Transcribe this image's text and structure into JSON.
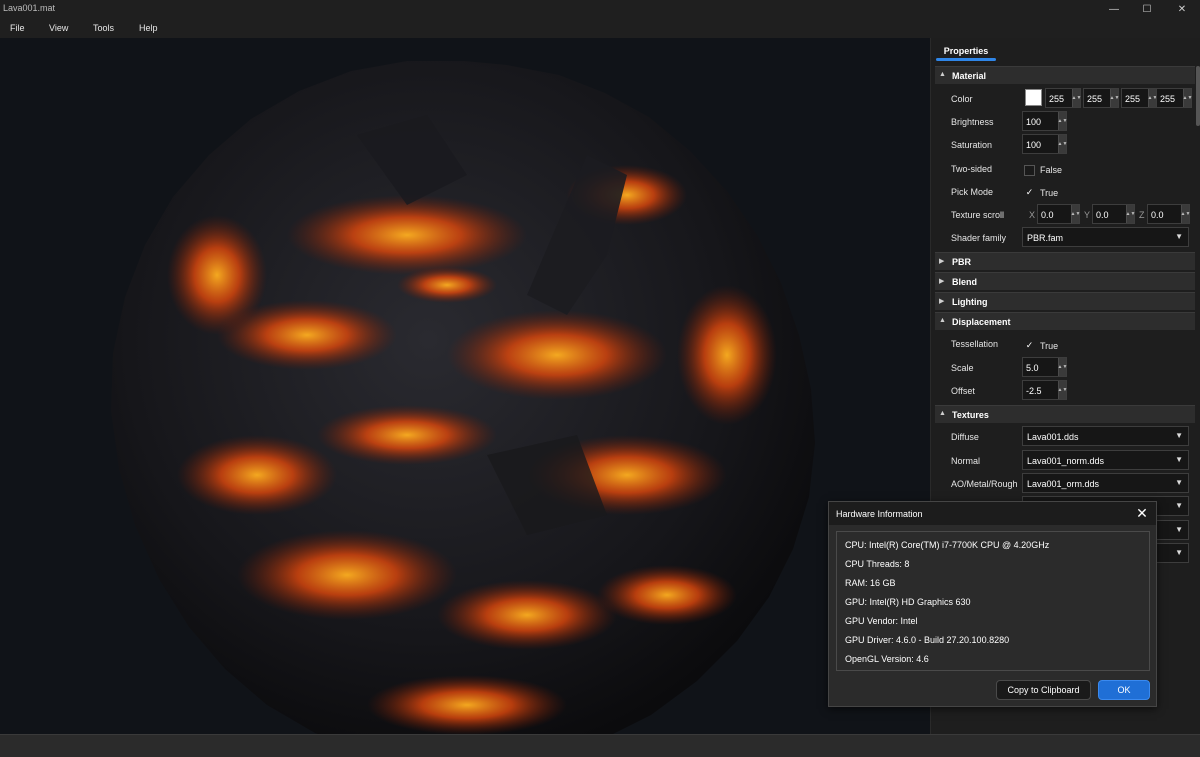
{
  "window": {
    "title": "Lava001.mat",
    "minimize": "—",
    "maximize": "☐",
    "close": "✕"
  },
  "menu": [
    "File",
    "View",
    "Tools",
    "Help"
  ],
  "panel": {
    "tab": "Properties",
    "sections": {
      "material": "Material",
      "pbr": "PBR",
      "blend": "Blend",
      "lighting": "Lighting",
      "displacement": "Displacement",
      "textures": "Textures"
    },
    "material": {
      "color_label": "Color",
      "color_swatch": "#ffffff",
      "color_values": [
        "255",
        "255",
        "255",
        "255"
      ],
      "brightness_label": "Brightness",
      "brightness": "100",
      "saturation_label": "Saturation",
      "saturation": "100",
      "two_sided_label": "Two-sided",
      "two_sided": "False",
      "pick_mode_label": "Pick Mode",
      "pick_mode": "True",
      "texture_scroll_label": "Texture scroll",
      "scroll_axes": [
        "X",
        "Y",
        "Z"
      ],
      "scroll_values": [
        "0.0",
        "0.0",
        "0.0"
      ],
      "shader_family_label": "Shader family",
      "shader_family": "PBR.fam"
    },
    "displacement": {
      "tessellation_label": "Tessellation",
      "tessellation": "True",
      "scale_label": "Scale",
      "scale": "5.0",
      "offset_label": "Offset",
      "offset": "-2.5"
    },
    "textures": {
      "diffuse_label": "Diffuse",
      "diffuse": "Lava001.dds",
      "normal_label": "Normal",
      "normal": "Lava001_norm.dds",
      "aomr_label": "AO/Metal/Rough",
      "aomr": "Lava001_orm.dds"
    }
  },
  "dialog": {
    "title": "Hardware Information",
    "lines": [
      "CPU: Intel(R) Core(TM) i7-7700K CPU @ 4.20GHz",
      "CPU Threads: 8",
      "RAM: 16 GB",
      "GPU: Intel(R) HD Graphics 630",
      "GPU Vendor: Intel",
      "GPU Driver: 4.6.0 - Build 27.20.100.8280",
      "OpenGL Version: 4.6"
    ],
    "copy_button": "Copy to Clipboard",
    "ok_button": "OK"
  },
  "colors": {
    "accent": "#2f86e8",
    "ok_button": "#1f6fd6",
    "viewport_bg": "#101318"
  }
}
